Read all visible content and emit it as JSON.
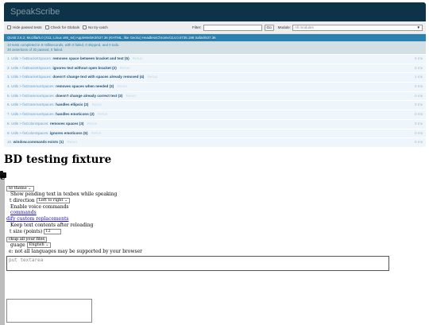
{
  "header": {
    "title": "SpeakScribe"
  },
  "toolbar": {
    "hide_passed_label": "Hide passed tests",
    "check_globals_label": "Check for Globals",
    "no_try_catch_label": "No try-catch",
    "filter_label": "Filter:",
    "filter_value": "",
    "go_label": "Go",
    "module_label": "Module:",
    "module_value": "All modules"
  },
  "user_agent": "QUnit 2.6.2; Mozilla/5.0 (X11; Linux x86_64) AppleWebKit/537.36 (KHTML, like Gecko) HeadlessChrome/114.0.5735.198 Safari/537.36",
  "test_result": {
    "line1": "10 tests completed in 8 milliseconds, with 0 failed, 0 skipped, and 0 todo.",
    "line2": "30 assertions of 30 passed, 0 failed."
  },
  "tests": [
    {
      "num": "1.",
      "module": "Utils > fixBracketSpaces:",
      "name": "removes space between bracket and text",
      "counts": "(5)",
      "rerun": "Rerun",
      "time": "0 ms"
    },
    {
      "num": "2.",
      "module": "Utils > fixBracketSpaces:",
      "name": "ignores text without open bracket",
      "counts": "(2)",
      "rerun": "Rerun",
      "time": "0 ms"
    },
    {
      "num": "3.",
      "module": "Utils > fixBracketSpaces:",
      "name": "doesn't change text with spaces already removed",
      "counts": "(4)",
      "rerun": "Rerun",
      "time": "1 ms"
    },
    {
      "num": "4.",
      "module": "Utils > fixGrammarSpaces:",
      "name": "removes spaces when needed",
      "counts": "(3)",
      "rerun": "Rerun",
      "time": "0 ms"
    },
    {
      "num": "5.",
      "module": "Utils > fixGrammarSpaces:",
      "name": "doesn't change already correct text",
      "counts": "(3)",
      "rerun": "Rerun",
      "time": "0 ms"
    },
    {
      "num": "6.",
      "module": "Utils > fixGrammarSpaces:",
      "name": "handles ellipsis",
      "counts": "(2)",
      "rerun": "Rerun",
      "time": "0 ms"
    },
    {
      "num": "7.",
      "module": "Utils > fixGrammarSpaces:",
      "name": "handles emoticons",
      "counts": "(2)",
      "rerun": "Rerun",
      "time": "0 ms"
    },
    {
      "num": "8.",
      "module": "Utils > fixColonSpaces:",
      "name": "removes spaces",
      "counts": "(3)",
      "rerun": "Rerun",
      "time": "0 ms"
    },
    {
      "num": "9.",
      "module": "Utils > fixColonSpaces:",
      "name": "ignores emoticons",
      "counts": "(5)",
      "rerun": "Rerun",
      "time": "0 ms"
    },
    {
      "num": "10.",
      "module": "",
      "name": "window.commands exists",
      "counts": "(1)",
      "rerun": "Rerun",
      "time": "0 ms"
    }
  ],
  "fixture": {
    "title": "BD testing fixture",
    "glyph": "e",
    "theme_select": "ht theme",
    "show_pending_label": "Show pending text in texbox while speaking",
    "direction_label": "t direction",
    "direction_select": "Left to right",
    "enable_voice_label": "Enable voice commands",
    "commands_link": "commands",
    "custom_replacements_link": "dify custom replacements",
    "keep_text_label": "Keep text contents after reloading",
    "font_size_label": "t size (points)",
    "font_size_value": "12",
    "backup_button": "ckup all your files",
    "language_label": "guage",
    "language_select": "English",
    "language_note": "e: not all languages may be supported by your browser",
    "textarea_placeholder": "put textarea"
  },
  "colors": {
    "header_bg": "#0d3349",
    "useragent_bg": "#2b81af",
    "result_bg": "#d2e0e6",
    "row_bg": "#eef6fb"
  }
}
